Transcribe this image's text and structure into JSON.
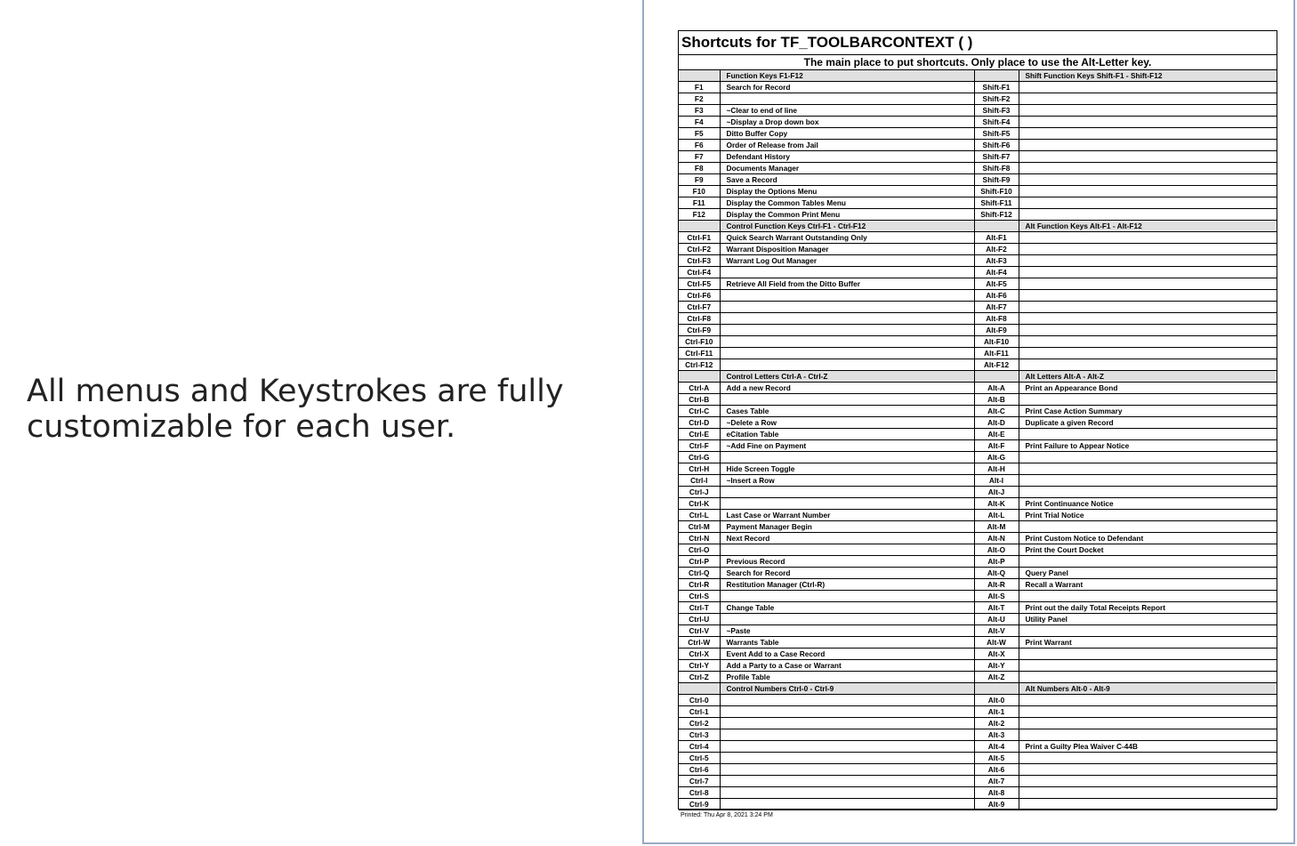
{
  "caption": "All menus and Keystrokes are fully customizable for each user.",
  "title": "Shortcuts for TF_TOOLBARCONTEXT ( )",
  "subtitle": "The main place to put shortcuts.  Only place to use the Alt-Letter key.",
  "printed": "Printed: Thu Apr 8, 2021 3:24 PM",
  "sections": [
    {
      "left_header": "Function Keys F1-F12",
      "right_header": "Shift Function Keys Shift-F1 - Shift-F12",
      "rows": [
        {
          "lk": "F1",
          "ld": "Search for Record",
          "rk": "Shift-F1",
          "rd": ""
        },
        {
          "lk": "F2",
          "ld": "",
          "rk": "Shift-F2",
          "rd": ""
        },
        {
          "lk": "F3",
          "ld": "~Clear to end of line",
          "rk": "Shift-F3",
          "rd": ""
        },
        {
          "lk": "F4",
          "ld": "~Display a Drop down box",
          "rk": "Shift-F4",
          "rd": ""
        },
        {
          "lk": "F5",
          "ld": "Ditto Buffer Copy",
          "rk": "Shift-F5",
          "rd": ""
        },
        {
          "lk": "F6",
          "ld": "Order of Release from Jail",
          "rk": "Shift-F6",
          "rd": ""
        },
        {
          "lk": "F7",
          "ld": "Defendant History",
          "rk": "Shift-F7",
          "rd": ""
        },
        {
          "lk": "F8",
          "ld": "Documents Manager",
          "rk": "Shift-F8",
          "rd": ""
        },
        {
          "lk": "F9",
          "ld": "Save a Record",
          "rk": "Shift-F9",
          "rd": ""
        },
        {
          "lk": "F10",
          "ld": "Display the Options Menu",
          "rk": "Shift-F10",
          "rd": ""
        },
        {
          "lk": "F11",
          "ld": "Display the Common Tables Menu",
          "rk": "Shift-F11",
          "rd": ""
        },
        {
          "lk": "F12",
          "ld": "Display the Common Print Menu",
          "rk": "Shift-F12",
          "rd": ""
        }
      ]
    },
    {
      "left_header": "Control Function Keys Ctrl-F1 - Ctrl-F12",
      "right_header": "Alt Function Keys Alt-F1 - Alt-F12",
      "rows": [
        {
          "lk": "Ctrl-F1",
          "ld": "Quick Search Warrant Outstanding Only",
          "rk": "Alt-F1",
          "rd": ""
        },
        {
          "lk": "Ctrl-F2",
          "ld": "Warrant Disposition Manager",
          "rk": "Alt-F2",
          "rd": ""
        },
        {
          "lk": "Ctrl-F3",
          "ld": "Warrant Log Out Manager",
          "rk": "Alt-F3",
          "rd": ""
        },
        {
          "lk": "Ctrl-F4",
          "ld": "",
          "rk": "Alt-F4",
          "rd": ""
        },
        {
          "lk": "Ctrl-F5",
          "ld": "Retrieve All Field from the Ditto Buffer",
          "rk": "Alt-F5",
          "rd": ""
        },
        {
          "lk": "Ctrl-F6",
          "ld": "",
          "rk": "Alt-F6",
          "rd": ""
        },
        {
          "lk": "Ctrl-F7",
          "ld": "",
          "rk": "Alt-F7",
          "rd": ""
        },
        {
          "lk": "Ctrl-F8",
          "ld": "",
          "rk": "Alt-F8",
          "rd": ""
        },
        {
          "lk": "Ctrl-F9",
          "ld": "",
          "rk": "Alt-F9",
          "rd": ""
        },
        {
          "lk": "Ctrl-F10",
          "ld": "",
          "rk": "Alt-F10",
          "rd": ""
        },
        {
          "lk": "Ctrl-F11",
          "ld": "",
          "rk": "Alt-F11",
          "rd": ""
        },
        {
          "lk": "Ctrl-F12",
          "ld": "",
          "rk": "Alt-F12",
          "rd": ""
        }
      ]
    },
    {
      "left_header": "Control Letters Ctrl-A - Ctrl-Z",
      "right_header": "Alt Letters Alt-A - Alt-Z",
      "rows": [
        {
          "lk": "Ctrl-A",
          "ld": "Add a new Record",
          "rk": "Alt-A",
          "rd": "Print an Appearance Bond"
        },
        {
          "lk": "Ctrl-B",
          "ld": "",
          "rk": "Alt-B",
          "rd": ""
        },
        {
          "lk": "Ctrl-C",
          "ld": "Cases Table",
          "rk": "Alt-C",
          "rd": "Print Case Action Summary"
        },
        {
          "lk": "Ctrl-D",
          "ld": "~Delete a Row",
          "rk": "Alt-D",
          "rd": "Duplicate a given Record"
        },
        {
          "lk": "Ctrl-E",
          "ld": "eCitation Table",
          "rk": "Alt-E",
          "rd": ""
        },
        {
          "lk": "Ctrl-F",
          "ld": "~Add Fine on Payment",
          "rk": "Alt-F",
          "rd": "Print Failure to Appear Notice"
        },
        {
          "lk": "Ctrl-G",
          "ld": "",
          "rk": "Alt-G",
          "rd": ""
        },
        {
          "lk": "Ctrl-H",
          "ld": "Hide Screen Toggle",
          "rk": "Alt-H",
          "rd": ""
        },
        {
          "lk": "Ctrl-I",
          "ld": "~Insert a Row",
          "rk": "Alt-I",
          "rd": ""
        },
        {
          "lk": "Ctrl-J",
          "ld": "",
          "rk": "Alt-J",
          "rd": ""
        },
        {
          "lk": "Ctrl-K",
          "ld": "",
          "rk": "Alt-K",
          "rd": "Print Continuance Notice"
        },
        {
          "lk": "Ctrl-L",
          "ld": "Last Case or Warrant Number",
          "rk": "Alt-L",
          "rd": "Print Trial Notice"
        },
        {
          "lk": "Ctrl-M",
          "ld": "Payment Manager Begin",
          "rk": "Alt-M",
          "rd": ""
        },
        {
          "lk": "Ctrl-N",
          "ld": "Next Record",
          "rk": "Alt-N",
          "rd": "Print Custom Notice to Defendant"
        },
        {
          "lk": "Ctrl-O",
          "ld": "",
          "rk": "Alt-O",
          "rd": "Print the Court Docket"
        },
        {
          "lk": "Ctrl-P",
          "ld": "Previous Record",
          "rk": "Alt-P",
          "rd": ""
        },
        {
          "lk": "Ctrl-Q",
          "ld": "Search for Record",
          "rk": "Alt-Q",
          "rd": "Query Panel"
        },
        {
          "lk": "Ctrl-R",
          "ld": "Restitution Manager (Ctrl-R)",
          "rk": "Alt-R",
          "rd": "Recall a Warrant"
        },
        {
          "lk": "Ctrl-S",
          "ld": "",
          "rk": "Alt-S",
          "rd": ""
        },
        {
          "lk": "Ctrl-T",
          "ld": "Change Table",
          "rk": "Alt-T",
          "rd": "Print out the daily Total Receipts Report"
        },
        {
          "lk": "Ctrl-U",
          "ld": "",
          "rk": "Alt-U",
          "rd": "Utility Panel"
        },
        {
          "lk": "Ctrl-V",
          "ld": "~Paste",
          "rk": "Alt-V",
          "rd": ""
        },
        {
          "lk": "Ctrl-W",
          "ld": "Warrants Table",
          "rk": "Alt-W",
          "rd": "Print Warrant"
        },
        {
          "lk": "Ctrl-X",
          "ld": "Event Add to a Case Record",
          "rk": "Alt-X",
          "rd": ""
        },
        {
          "lk": "Ctrl-Y",
          "ld": "Add a Party to a Case or Warrant",
          "rk": "Alt-Y",
          "rd": ""
        },
        {
          "lk": "Ctrl-Z",
          "ld": "Profile Table",
          "rk": "Alt-Z",
          "rd": ""
        }
      ]
    },
    {
      "left_header": "Control Numbers Ctrl-0 - Ctrl-9",
      "right_header": "Alt Numbers Alt-0 - Alt-9",
      "rows": [
        {
          "lk": "Ctrl-0",
          "ld": "",
          "rk": "Alt-0",
          "rd": ""
        },
        {
          "lk": "Ctrl-1",
          "ld": "",
          "rk": "Alt-1",
          "rd": ""
        },
        {
          "lk": "Ctrl-2",
          "ld": "",
          "rk": "Alt-2",
          "rd": ""
        },
        {
          "lk": "Ctrl-3",
          "ld": "",
          "rk": "Alt-3",
          "rd": ""
        },
        {
          "lk": "Ctrl-4",
          "ld": "",
          "rk": "Alt-4",
          "rd": "Print a Guilty Plea Waiver C-44B"
        },
        {
          "lk": "Ctrl-5",
          "ld": "",
          "rk": "Alt-5",
          "rd": ""
        },
        {
          "lk": "Ctrl-6",
          "ld": "",
          "rk": "Alt-6",
          "rd": ""
        },
        {
          "lk": "Ctrl-7",
          "ld": "",
          "rk": "Alt-7",
          "rd": ""
        },
        {
          "lk": "Ctrl-8",
          "ld": "",
          "rk": "Alt-8",
          "rd": ""
        },
        {
          "lk": "Ctrl-9",
          "ld": "",
          "rk": "Alt-9",
          "rd": ""
        }
      ]
    }
  ]
}
